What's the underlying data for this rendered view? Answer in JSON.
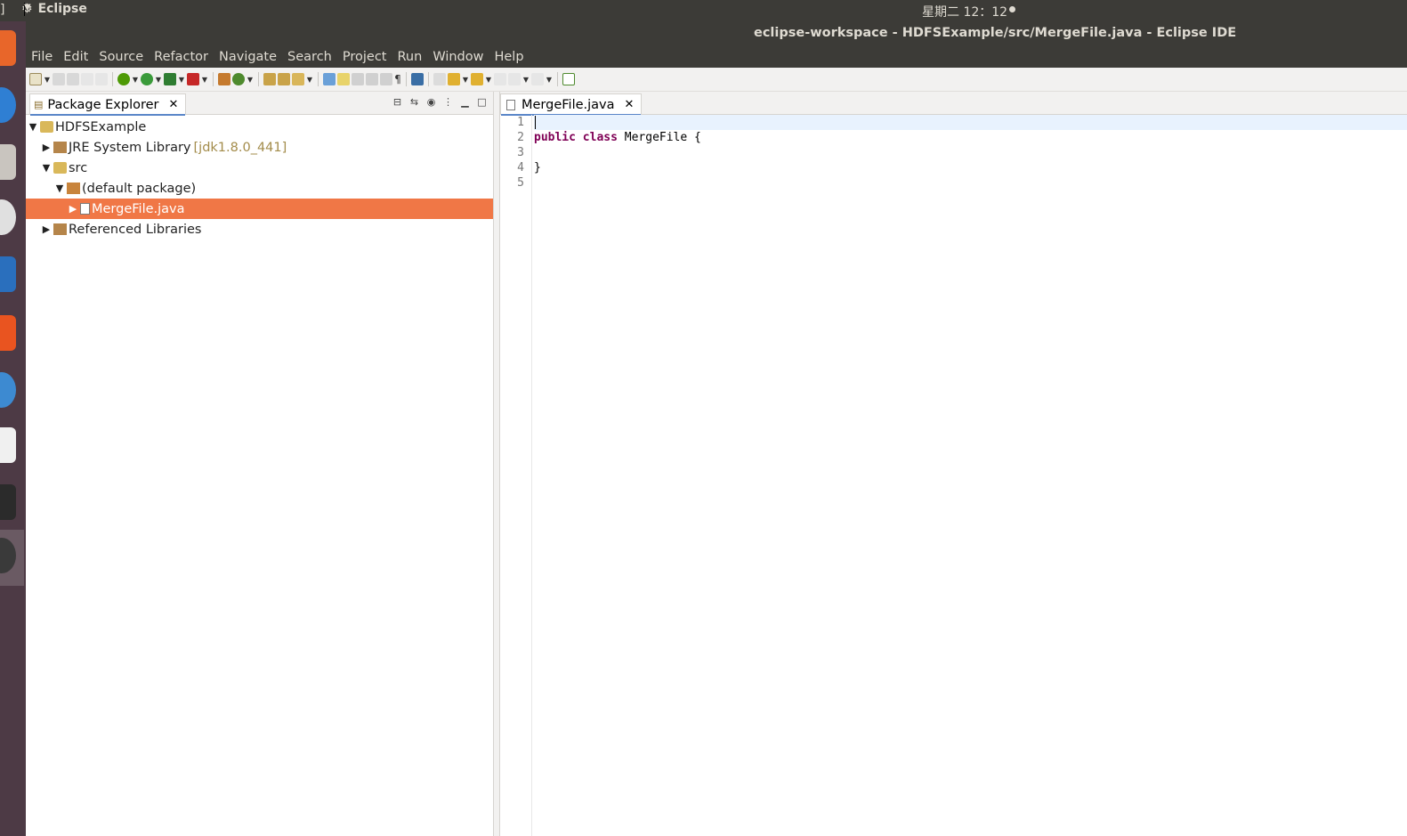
{
  "topbar": {
    "edge_glyph": "]",
    "app_name": "Eclipse",
    "clock": "星期二 12：12"
  },
  "window": {
    "title": "eclipse-workspace - HDFSExample/src/MergeFile.java - Eclipse IDE"
  },
  "menu": [
    "File",
    "Edit",
    "Source",
    "Refactor",
    "Navigate",
    "Search",
    "Project",
    "Run",
    "Window",
    "Help"
  ],
  "package_explorer": {
    "tab_label": "Package Explorer",
    "tree": [
      {
        "label": "HDFSExample",
        "expanded": true,
        "icon": "project-folder-icon"
      },
      {
        "label": "JRE System Library",
        "decoration": "[jdk1.8.0_441]",
        "expanded": false,
        "icon": "library-icon"
      },
      {
        "label": "src",
        "expanded": true,
        "icon": "source-folder-icon"
      },
      {
        "label": "(default package)",
        "expanded": true,
        "icon": "package-icon"
      },
      {
        "label": "MergeFile.java",
        "expanded": false,
        "selected": true,
        "icon": "java-file-icon"
      },
      {
        "label": "Referenced Libraries",
        "expanded": false,
        "icon": "library-icon"
      }
    ]
  },
  "editor": {
    "tab_label": "MergeFile.java",
    "line_numbers": [
      "1",
      "2",
      "3",
      "4",
      "5"
    ],
    "code": {
      "l1": "",
      "l2_kw1": "public",
      "l2_kw2": "class",
      "l2_rest": " MergeFile {",
      "l3": "",
      "l4": "}",
      "l5": ""
    }
  },
  "colors": {
    "selection": "#f07746",
    "topbar": "#3c3b37",
    "dock": "#4d3a45",
    "keyword": "#7f0055"
  }
}
